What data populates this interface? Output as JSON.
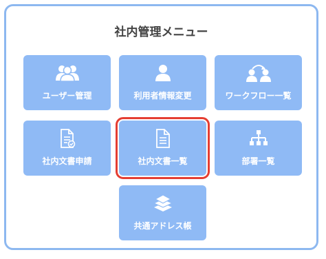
{
  "menu": {
    "title": "社内管理メニュー",
    "items": [
      {
        "label": "ユーザー管理",
        "icon": "users-icon"
      },
      {
        "label": "利用者情報変更",
        "icon": "user-icon"
      },
      {
        "label": "ワークフロー一覧",
        "icon": "workflow-icon"
      },
      {
        "label": "社内文書申請",
        "icon": "document-check-icon"
      },
      {
        "label": "社内文書一覧",
        "icon": "document-icon"
      },
      {
        "label": "部署一覧",
        "icon": "org-chart-icon"
      },
      {
        "label": "共通アドレス帳",
        "icon": "address-book-icon"
      }
    ],
    "selected_label": "社内文書一覧"
  },
  "colors": {
    "tile": "#8fbaf5",
    "panel_border": "#8db8f0",
    "highlight": "#e53e32",
    "title_text": "#444444"
  }
}
